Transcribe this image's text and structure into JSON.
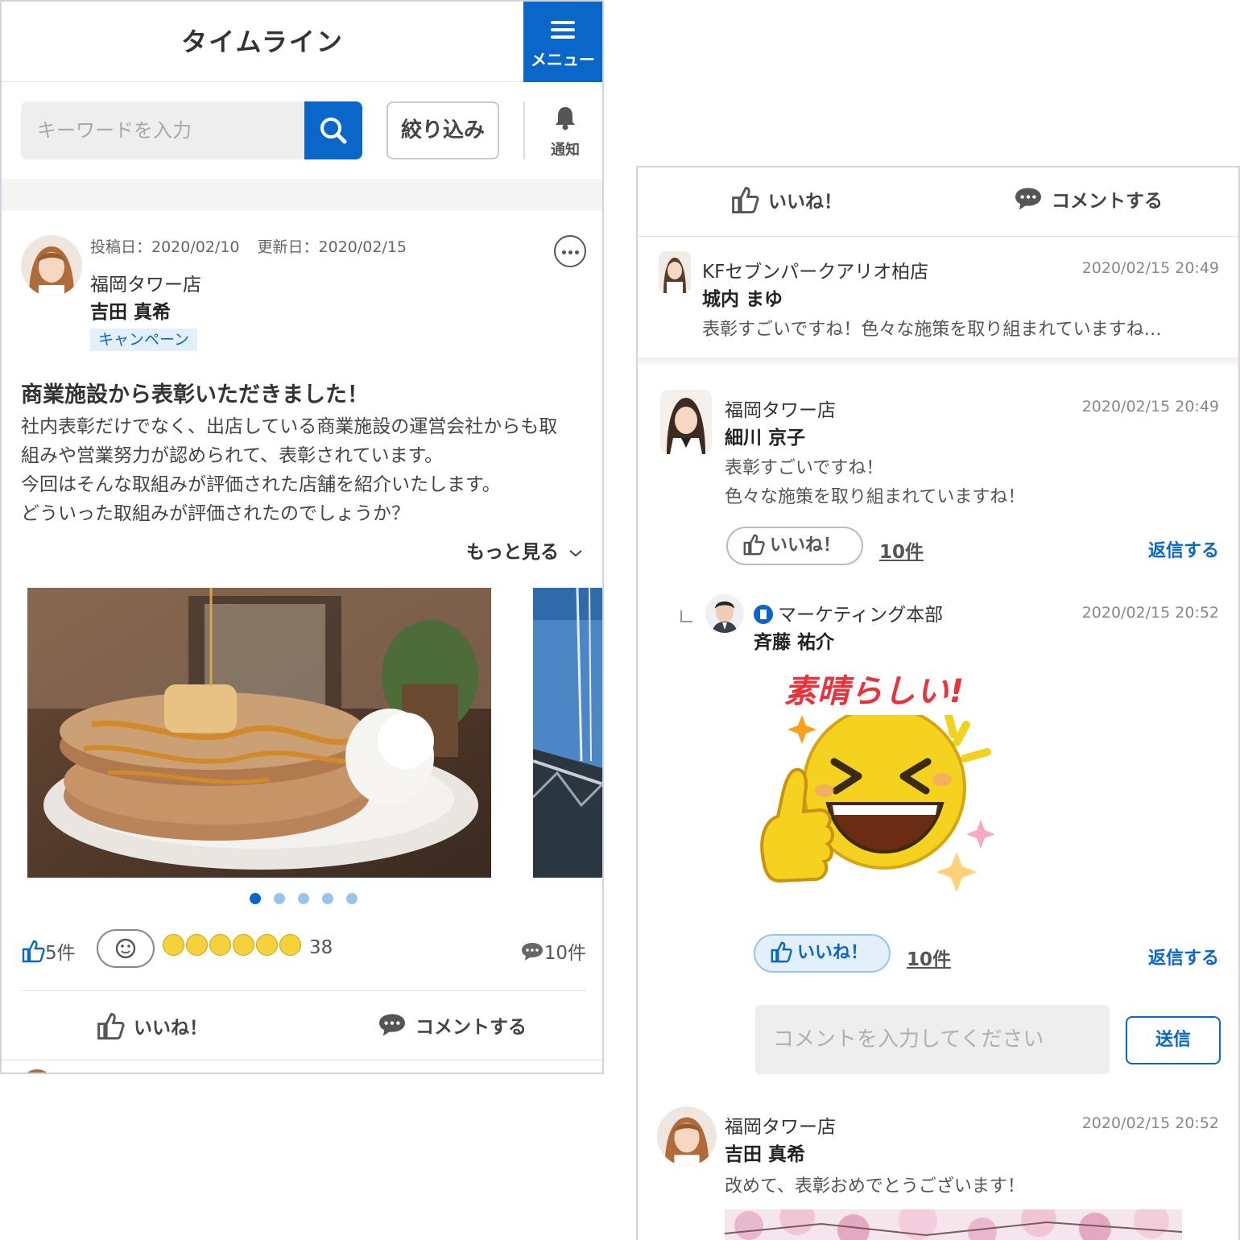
{
  "header": {
    "title": "タイムライン",
    "menu_label": "メニュー"
  },
  "search": {
    "placeholder": "キーワードを入力",
    "filter_label": "絞り込み",
    "notify_label": "通知"
  },
  "post": {
    "posted_label": "投稿日：2020/02/10",
    "updated_label": "更新日：2020/02/15",
    "store": "福岡タワー店",
    "author": "吉田 真希",
    "tag": "キャンペーン",
    "title": "商業施設から表彰いただきました！",
    "body": [
      "社内表彰だけでなく、出店している商業施設の運営会社からも取",
      "組みや営業努力が認められて、表彰されています。",
      "今回はそんな取組みが評価された店舗を紹介いたします。",
      "どういった取組みが評価されたのでしょうか？"
    ],
    "see_more": "もっと見る",
    "carousel": {
      "total": 5,
      "current": 1
    },
    "likes": "5件",
    "reaction_count": "38",
    "comments": "10件",
    "like_action": "いいね！",
    "comment_action": "コメントする"
  },
  "detail": {
    "like_action": "いいね！",
    "comment_action": "コメントする",
    "comments": [
      {
        "store": "KFセブンパークアリオ柏店",
        "name": "城内 まゆ",
        "date": "2020/02/15 20:49",
        "text": [
          "表彰すごいですね！色々な施策を取り組まれていますね…"
        ]
      },
      {
        "store": "福岡タワー店",
        "name": "細川 京子",
        "date": "2020/02/15 20:49",
        "text": [
          "表彰すごいですね！",
          "色々な施策を取り組まれていますね！"
        ],
        "like_label": "いいね！",
        "like_count": "10件",
        "reply_label": "返信する"
      },
      {
        "store": "マーケティング本部",
        "name": "斉藤 祐介",
        "date": "2020/02/15 20:52",
        "stamp_text": "素晴らしい!",
        "like_label": "いいね！",
        "like_count": "10件",
        "reply_label": "返信する"
      },
      {
        "store": "福岡タワー店",
        "name": "吉田 真希",
        "date": "2020/02/15 20:52",
        "text": [
          "改めて、表彰おめでとうございます！"
        ]
      }
    ],
    "input_placeholder": "コメントを入力してください",
    "send_label": "送信"
  },
  "colors": {
    "accent": "#0a67c9",
    "stamp": "#e8323c"
  },
  "icons": [
    "menu-icon",
    "search-icon",
    "bell-icon",
    "more-icon",
    "thumbs-up-icon",
    "speech-bubble-icon",
    "smiley-icon",
    "chevron-down-icon",
    "building-icon"
  ]
}
